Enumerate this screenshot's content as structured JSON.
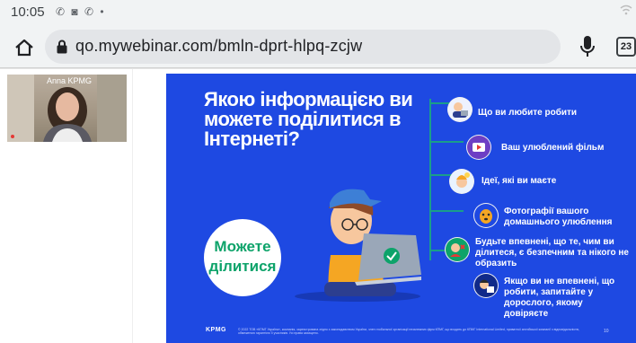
{
  "status_bar": {
    "time": "10:05",
    "notification_icons": [
      "viber-icon",
      "gamepad-icon",
      "viber-icon"
    ],
    "dot": "•"
  },
  "address_bar": {
    "url": "qo.mywebinar.com/bmln-dprt-hlpq-zcjw",
    "tab_count": "23"
  },
  "webcam": {
    "name": "Anna KPMG"
  },
  "slide": {
    "title_lines": [
      "Якою інформацією ви",
      "можете поділитися в",
      "Інтернеті?"
    ],
    "bubble_lines": [
      "Можете",
      "ділитися"
    ],
    "items": [
      {
        "text": "Що ви любите робити"
      },
      {
        "text": "Ваш улюблений фільм"
      },
      {
        "text": "Ідеї, які ви маєте"
      },
      {
        "text": "Фотографії вашого домашнього улюблення"
      },
      {
        "text": "Будьте впевнені, що те, чим ви ділитеся, є безпечним та нікого не образить"
      },
      {
        "text": "Якщо ви не впевнені, що робити, запитайте у дорослого, якому довіряєте"
      }
    ],
    "logo": "KPMG",
    "footer_text": "© 2022 ТОВ «КПМГ Україна», компанія, зареєстрована згідно з законодавством України, член глобальної організації незалежних фірм КПМГ, що входять до КПМГ International Limited, приватної англійської компанії з відповідальністю, обмеженою гарантією її учасників. Усі права захищено.",
    "page_number": "10"
  },
  "colors": {
    "slide_bg": "#1e49e2",
    "accent_green": "#0da36a",
    "connector": "#1a9e8a"
  }
}
